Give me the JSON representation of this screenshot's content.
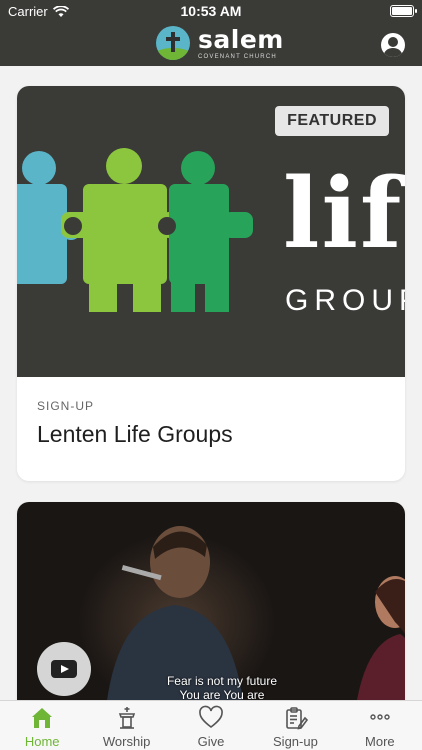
{
  "status": {
    "carrier": "Carrier",
    "time": "10:53 AM"
  },
  "header": {
    "brand_name": "salem",
    "brand_sub": "COVENANT CHURCH"
  },
  "cards": [
    {
      "badge": "FEATURED",
      "art_word": "life",
      "art_sub": "GROUP",
      "category": "SIGN-UP",
      "title": "Lenten Life Groups"
    },
    {
      "caption_line1": "Fear is not my future",
      "caption_line2": "You are You are"
    }
  ],
  "tabs": [
    {
      "label": "Home",
      "icon": "home-icon",
      "active": true
    },
    {
      "label": "Worship",
      "icon": "pulpit-icon",
      "active": false
    },
    {
      "label": "Give",
      "icon": "heart-icon",
      "active": false
    },
    {
      "label": "Sign-up",
      "icon": "clipboard-icon",
      "active": false
    },
    {
      "label": "More",
      "icon": "ellipsis-icon",
      "active": false
    }
  ],
  "colors": {
    "header_bg": "#3a3a37",
    "accent_green": "#6fb536",
    "accent_blue": "#5ab5c9"
  }
}
